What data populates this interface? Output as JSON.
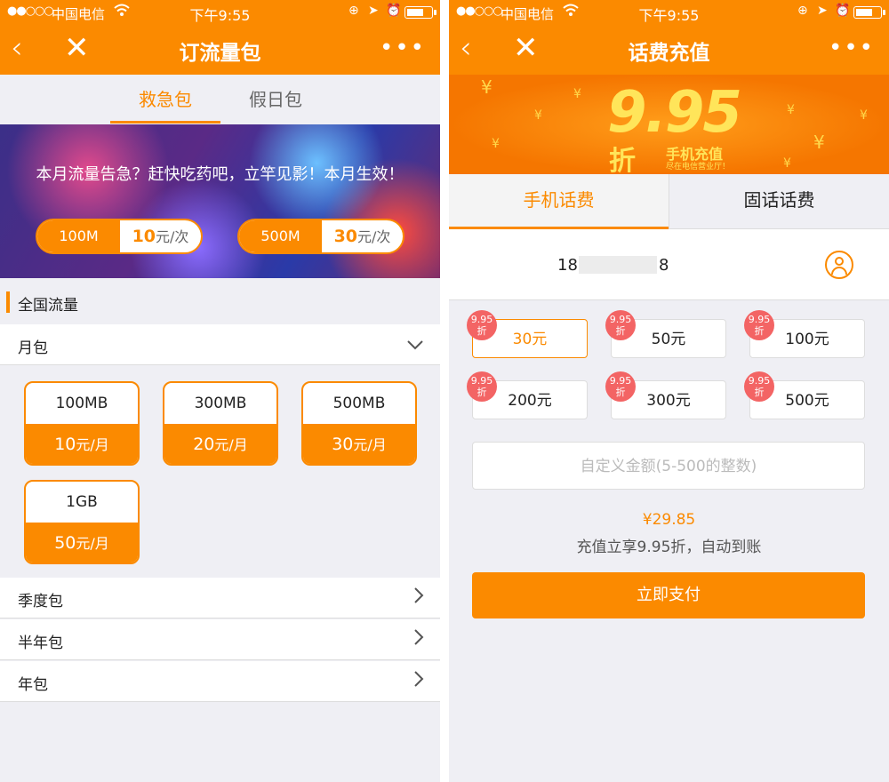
{
  "status": {
    "signal": "●●○○○",
    "carrier": "中国电信",
    "time": "下午9:55"
  },
  "left": {
    "title": "订流量包",
    "tabs": [
      "救急包",
      "假日包"
    ],
    "banner_text": "本月流量告急？赶快吃药吧，立竿见影！本月生效！",
    "pills": [
      {
        "amount": "100M",
        "price": "10",
        "unit": "元/次"
      },
      {
        "amount": "500M",
        "price": "30",
        "unit": "元/次"
      }
    ],
    "section": "全国流量",
    "monthly": "月包",
    "plans": [
      {
        "size": "100MB",
        "price": "10",
        "unit": "元/月"
      },
      {
        "size": "300MB",
        "price": "20",
        "unit": "元/月"
      },
      {
        "size": "500MB",
        "price": "30",
        "unit": "元/月"
      },
      {
        "size": "1GB",
        "price": "50",
        "unit": "元/月"
      }
    ],
    "rows": [
      "季度包",
      "半年包",
      "年包"
    ]
  },
  "right": {
    "title": "话费充值",
    "banner": {
      "big": "9.95",
      "zhe": "折",
      "caption": "手机充值",
      "sub": "尽在电信营业厅！"
    },
    "tabs": [
      "手机话费",
      "固话话费"
    ],
    "phone_start": "18",
    "phone_end": "8",
    "badge_top": "9.95",
    "badge_bottom": "折",
    "amounts": [
      "30元",
      "50元",
      "100元",
      "200元",
      "300元",
      "500元"
    ],
    "custom_placeholder": "自定义金额(5-500的整数)",
    "total": "¥29.85",
    "note": "充值立享9.95折，自动到账",
    "pay": "立即支付"
  },
  "colors": {
    "accent": "#fb8a00",
    "badge": "#f36464"
  }
}
